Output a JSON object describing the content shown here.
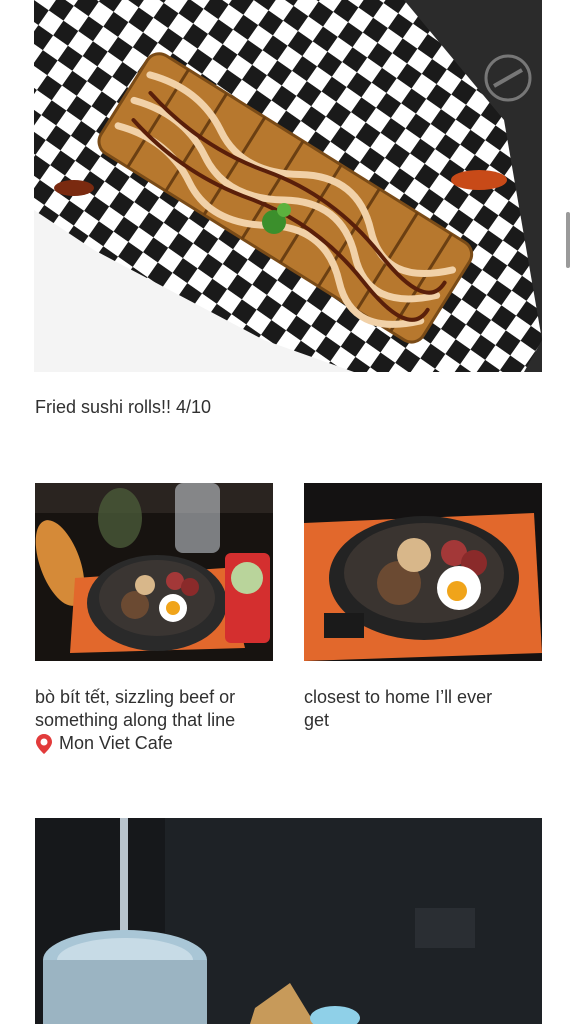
{
  "posts": [
    {
      "caption": "Fried sushi rolls!! 4/10",
      "image": "fried-sushi-rolls-photo"
    },
    {
      "caption_lines": [
        "bò bít tết, sizzling beef or",
        "something along that line"
      ],
      "location_icon": "map-pin-icon",
      "location": "Mon Viet Cafe",
      "image": "sizzling-beef-plate-photo"
    },
    {
      "caption_lines": [
        "closest to home I’ll ever",
        "get"
      ],
      "image": "sizzling-beef-closeup-photo"
    },
    {
      "image": "night-drink-photo"
    }
  ],
  "colors": {
    "text": "#303030",
    "checker_dark": "#1a1a1a",
    "checker_light": "#ffffff",
    "sauce": "#f1d1a8",
    "plank": "#e2682c",
    "pin": "#e23b3b"
  }
}
